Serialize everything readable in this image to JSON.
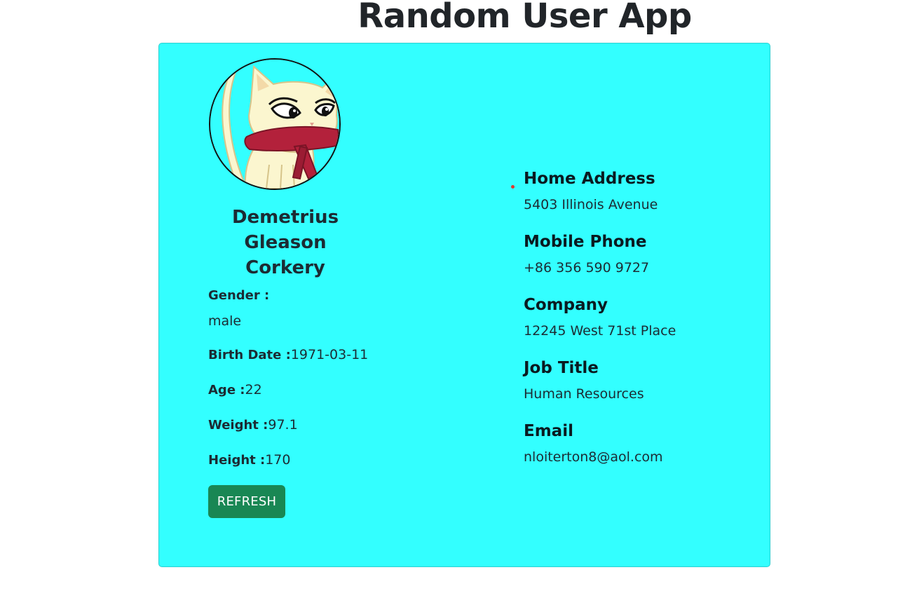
{
  "app": {
    "title": "Random User App"
  },
  "user": {
    "name": "Demetrius Gleason Corkery",
    "gender_label": "Gender :",
    "gender": "male",
    "birth_label": "Birth Date :",
    "birth_date": "1971-03-11",
    "age_label": "Age :",
    "age": "22",
    "weight_label": "Weight :",
    "weight": "97.1",
    "height_label": "Height :",
    "height": "170",
    "avatar": "cartoon-cat-with-red-scarf"
  },
  "details": {
    "home_address_label": "Home Address",
    "home_address": "5403 Illinois Avenue",
    "mobile_phone_label": "Mobile Phone",
    "mobile_phone": "+86 356 590 9727",
    "company_label": "Company",
    "company": "12245 West 71st Place",
    "job_title_label": "Job Title",
    "job_title": "Human Resources",
    "email_label": "Email",
    "email": "nloiterton8@aol.com"
  },
  "actions": {
    "refresh_label": "REFRESH"
  },
  "colors": {
    "card_background": "#33ffff",
    "button": "#198754",
    "text": "#212529"
  }
}
